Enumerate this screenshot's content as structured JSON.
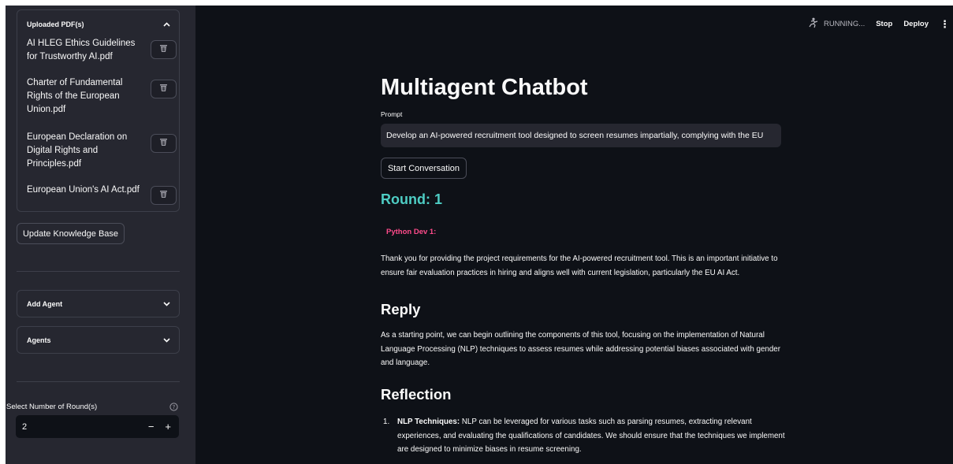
{
  "sidebar": {
    "uploaded_header": "Uploaded PDF(s)",
    "pdfs": [
      {
        "name": "AI HLEG Ethics Guidelines for Trustworthy AI.pdf"
      },
      {
        "name": "Charter of Fundamental Rights of the European Union.pdf"
      },
      {
        "name": "European Declaration on Digital Rights and Principles.pdf"
      },
      {
        "name": "European Union's AI Act.pdf"
      }
    ],
    "update_button": "Update Knowledge Base",
    "add_agent": "Add Agent",
    "agents": "Agents",
    "rounds_label": "Select Number of Round(s)",
    "rounds_value": "2",
    "minus": "−",
    "plus": "+"
  },
  "topbar": {
    "running": "RUNNING...",
    "stop": "Stop",
    "deploy": "Deploy"
  },
  "main": {
    "title": "Multiagent Chatbot",
    "prompt_label": "Prompt",
    "prompt_value": "Develop an AI-powered recruitment tool designed to screen resumes impartially, complying with the EU",
    "start_button": "Start Conversation",
    "round": "Round: 1",
    "speaker": "Python Dev 1:",
    "intro": "Thank you for providing the project requirements for the AI-powered recruitment tool. This is an important initiative to ensure fair evaluation practices in hiring and aligns well with current legislation, particularly the EU AI Act.",
    "reply_heading": "Reply",
    "reply_text": "As a starting point, we can begin outlining the components of this tool, focusing on the implementation of Natural Language Processing (NLP) techniques to assess resumes while addressing potential biases associated with gender and language.",
    "reflection_heading": "Reflection",
    "reflection_items": [
      {
        "num": "1.",
        "bold": "NLP Techniques:",
        "text": " NLP can be leveraged for various tasks such as parsing resumes, extracting relevant experiences, and evaluating the qualifications of candidates. We should ensure that the techniques we implement are designed to minimize biases in resume screening."
      }
    ]
  },
  "colors": {
    "background": "#0e1117",
    "sidebar": "#262730",
    "round_accent": "#4ecdc4",
    "speaker_accent": "#ff4b8b"
  }
}
